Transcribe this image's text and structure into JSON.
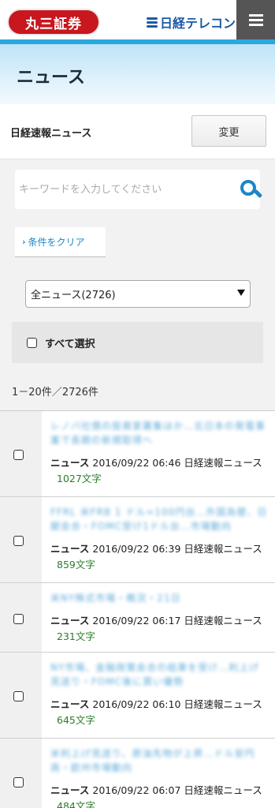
{
  "header": {
    "logo_left": "丸三証券",
    "logo_right": "日経テレコン",
    "menu_icon": "hamburger-menu-icon"
  },
  "page": {
    "title": "ニュース"
  },
  "category": {
    "label": "日経速報ニュース",
    "change_button": "変更"
  },
  "search": {
    "placeholder": "キーワードを入力してください",
    "icon": "search-icon"
  },
  "filters": {
    "clear_label": "条件をクリア",
    "select_value": "全ニュース(2726)",
    "select_all_label": "すべて選択"
  },
  "results": {
    "count_text": "1－20件／2726件"
  },
  "news": [
    {
      "headline": "レノバ社債の投資家募集ほか…北日本の発電事業で長期の新規取得へ",
      "kind": "ニュース",
      "datetime": "2016/09/22 06:46",
      "source": "日経速報ニュース",
      "chars": "1027文字"
    },
    {
      "headline": "FFRL 米FRB 1 ドル=100円台…外国為替、日銀会合・FOMC受け1ドル台…市場動向",
      "kind": "ニュース",
      "datetime": "2016/09/22 06:39",
      "source": "日経速報ニュース",
      "chars": "859文字"
    },
    {
      "headline": "米NY株式市場・概況・21日",
      "kind": "ニュース",
      "datetime": "2016/09/22 06:17",
      "source": "日経速報ニュース",
      "chars": "231文字"
    },
    {
      "headline": "NY市場、金融政策会合の結果を受け…利上げ見送り・FOMC後に買い優勢",
      "kind": "ニュース",
      "datetime": "2016/09/22 06:10",
      "source": "日経速報ニュース",
      "chars": "645文字"
    },
    {
      "headline": "米利上げ見送り、原油先物が上昇…ドル安円高・欧州市場動向",
      "kind": "ニュース",
      "datetime": "2016/09/22 06:07",
      "source": "日経速報ニュース",
      "chars": "484文字"
    }
  ],
  "colors": {
    "accent_blue": "#2aa7df",
    "link_blue": "#1a86c8",
    "logo_red": "#c8171e",
    "chars_green": "#2a7d2a"
  }
}
